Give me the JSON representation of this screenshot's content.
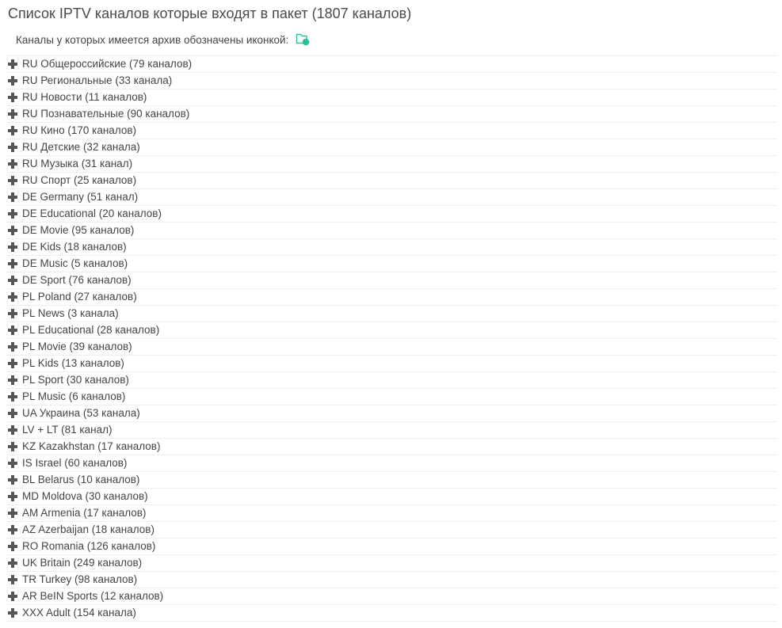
{
  "page": {
    "title": "Список IPTV каналов которые входят в пакет (1807 каналов)",
    "archive_note": "Каналы у которых имеется архив обозначены иконкой:",
    "archive_icon": "folder-archive-icon",
    "accent_color": "#2bbf9e"
  },
  "categories": [
    {
      "label": "RU Общероссийские (79 каналов)"
    },
    {
      "label": "RU Региональные (33 канала)"
    },
    {
      "label": "RU Новости (11 каналов)"
    },
    {
      "label": "RU Познавательные (90 каналов)"
    },
    {
      "label": "RU Кино (170 каналов)"
    },
    {
      "label": "RU Детские (32 канала)"
    },
    {
      "label": "RU Музыка (31 канал)"
    },
    {
      "label": "RU Спорт (25 каналов)"
    },
    {
      "label": "DE Germany (51 канал)"
    },
    {
      "label": "DE Educational (20 каналов)"
    },
    {
      "label": "DE Movie (95 каналов)"
    },
    {
      "label": "DE Kids (18 каналов)"
    },
    {
      "label": "DE Music (5 каналов)"
    },
    {
      "label": "DE Sport (76 каналов)"
    },
    {
      "label": "PL Poland (27 каналов)"
    },
    {
      "label": "PL News (3 канала)"
    },
    {
      "label": "PL Educational (28 каналов)"
    },
    {
      "label": "PL Movie (39 каналов)"
    },
    {
      "label": "PL Kids (13 каналов)"
    },
    {
      "label": "PL Sport (30 каналов)"
    },
    {
      "label": "PL Music (6 каналов)"
    },
    {
      "label": "UA Украина (53 канала)"
    },
    {
      "label": "LV + LT (81 канал)"
    },
    {
      "label": "KZ Kazakhstan (17 каналов)"
    },
    {
      "label": "IS Israel (60 каналов)"
    },
    {
      "label": "BL Belarus (10 каналов)"
    },
    {
      "label": "MD Moldova (30 каналов)"
    },
    {
      "label": "AM Armenia (17 каналов)"
    },
    {
      "label": "AZ Azerbaijan (18 каналов)"
    },
    {
      "label": "RO Romania (126 каналов)"
    },
    {
      "label": "UK Britain (249 каналов)"
    },
    {
      "label": "TR Turkey (98 каналов)"
    },
    {
      "label": "AR BeIN Sports (12 каналов)"
    },
    {
      "label": "XXX Adult (154 канала)"
    }
  ]
}
